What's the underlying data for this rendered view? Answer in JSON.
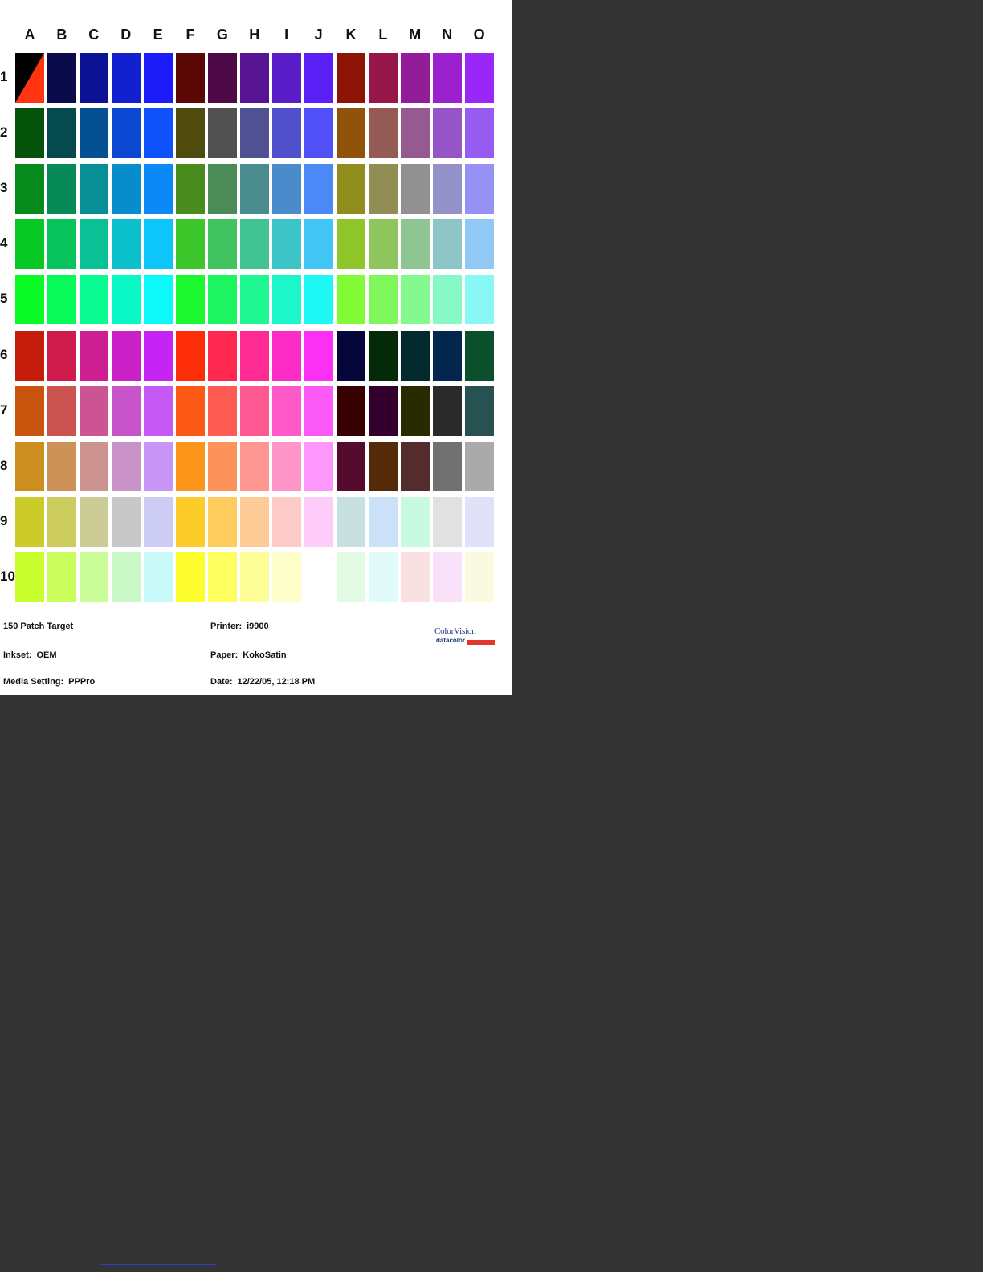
{
  "sheet": {
    "columns": [
      "A",
      "B",
      "C",
      "D",
      "E",
      "F",
      "G",
      "H",
      "I",
      "J",
      "K",
      "L",
      "M",
      "N",
      "O"
    ],
    "rows": [
      "1",
      "2",
      "3",
      "4",
      "5",
      "6",
      "7",
      "8",
      "9",
      "10"
    ],
    "patch_colors": [
      [
        "#000000",
        "#0b0a4a",
        "#0b1293",
        "#1320cf",
        "#1c1cf9",
        "#5a0705",
        "#4e0845",
        "#561493",
        "#5a1ec9",
        "#5a1ff5",
        "#8b1404",
        "#96164a",
        "#931c98",
        "#9a21cd",
        "#9927f7"
      ],
      [
        "#05520b",
        "#054b4e",
        "#054f93",
        "#0a48d1",
        "#0f52f9",
        "#4f4b0c",
        "#515151",
        "#515293",
        "#5150cc",
        "#514ff6",
        "#91520a",
        "#965a55",
        "#965a92",
        "#9555c7",
        "#975bf2"
      ],
      [
        "#078a1c",
        "#068a58",
        "#088f95",
        "#088dcc",
        "#0c89f6",
        "#4a8b1d",
        "#4a8b57",
        "#4a8b8d",
        "#4a8bcc",
        "#4c89f6",
        "#908d1c",
        "#928c55",
        "#919191",
        "#9291c8",
        "#9591f5"
      ],
      [
        "#08c924",
        "#09c45c",
        "#09c195",
        "#0bbfcb",
        "#0cc5f9",
        "#3ec72b",
        "#40c25e",
        "#3fc392",
        "#3dc4c7",
        "#42c6f5",
        "#8fc72b",
        "#8fc55d",
        "#8fc592",
        "#8dc5c6",
        "#92c8f5"
      ],
      [
        "#0afb26",
        "#09fb59",
        "#0afb91",
        "#0af8c6",
        "#0cf8f9",
        "#1cf92e",
        "#1df560",
        "#1ff892",
        "#1cf6c8",
        "#1df8f5",
        "#82fa35",
        "#80f75b",
        "#83f990",
        "#86f9c7",
        "#88f7f5"
      ],
      [
        "#c61c0a",
        "#cf1a4c",
        "#cd1f91",
        "#c921c7",
        "#c623f5",
        "#ff2e0a",
        "#ff2850",
        "#ff2a92",
        "#fd2ec6",
        "#fc30f5",
        "#05063a",
        "#052a08",
        "#022a2c",
        "#03264f",
        "#0a502a"
      ],
      [
        "#c8540d",
        "#cc5450",
        "#cc5492",
        "#c754c8",
        "#c459f5",
        "#fc5a14",
        "#ff5b55",
        "#fe5992",
        "#fe59c8",
        "#fc5af7",
        "#380000",
        "#33002d",
        "#282a00",
        "#2a2a2a",
        "#285252"
      ],
      [
        "#cc8e1e",
        "#cc9257",
        "#cc9391",
        "#c992c8",
        "#c894f5",
        "#fc961b",
        "#fc935a",
        "#fe9692",
        "#fe96c9",
        "#fe97fb",
        "#560a2d",
        "#552a09",
        "#552c2c",
        "#717171",
        "#aaaaaa"
      ],
      [
        "#cccc28",
        "#cccc5f",
        "#cccc96",
        "#c8c8c8",
        "#ccccf5",
        "#fdcc28",
        "#fdcc5d",
        "#fdcc96",
        "#fdccc9",
        "#fdccf9",
        "#c7e1e1",
        "#cae1f8",
        "#c8fae1",
        "#e1e1e1",
        "#e1e1f9"
      ],
      [
        "#c9fe2f",
        "#cafd5c",
        "#cafc97",
        "#caf9c8",
        "#c8f8f8",
        "#fefe2f",
        "#fdfe5f",
        "#fdfe96",
        "#fdfec9",
        "#ffffff",
        "#e1fae1",
        "#e1fafa",
        "#fae1e1",
        "#fae1fa",
        "#fafae1"
      ]
    ],
    "first_patch_split": {
      "top_left": "#000000",
      "bottom_right": "#ff3410"
    },
    "info": {
      "target": "150 Patch Target",
      "inkset_label": "Inkset:",
      "inkset_value": "OEM",
      "media_label": "Media Setting:",
      "media_value": "PPPro",
      "printer_label": "Printer:",
      "printer_value": "i9900",
      "paper_label": "Paper:",
      "paper_value": "KokoSatin",
      "date_label": "Date:",
      "date_value": "12/22/05, 12:18 PM"
    },
    "logo": {
      "top": "ColorVision",
      "bottom": "datacolor",
      "accent_color": "#e2382b"
    }
  },
  "background_color": "#333333"
}
